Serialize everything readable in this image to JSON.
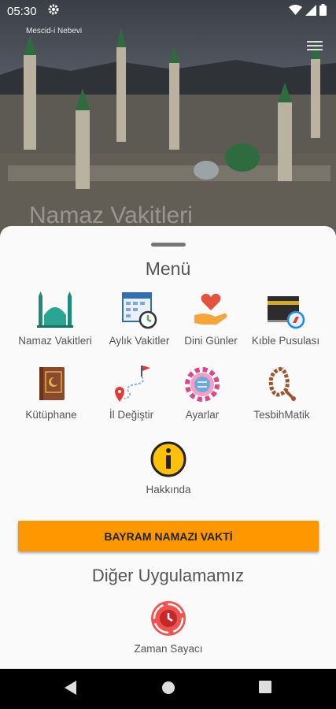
{
  "status": {
    "time": "05:30"
  },
  "header": {
    "place": "Mescid-i Nebevi",
    "bg_title": "Namaz Vakitleri"
  },
  "menu": {
    "title": "Menü",
    "items": [
      {
        "label": "Namaz Vakitleri",
        "icon": "mosque-icon"
      },
      {
        "label": "Aylık Vakitler",
        "icon": "monthly-calendar-icon"
      },
      {
        "label": "Dini Günler",
        "icon": "heart-hand-icon"
      },
      {
        "label": "Kıble Pusulası",
        "icon": "kaaba-compass-icon"
      },
      {
        "label": "Kütüphane",
        "icon": "book-icon"
      },
      {
        "label": "İl Değiştir",
        "icon": "route-pin-icon"
      },
      {
        "label": "Ayarlar",
        "icon": "gear-icon"
      },
      {
        "label": "TesbihMatik",
        "icon": "prayer-beads-icon"
      },
      {
        "label": "Hakkında",
        "icon": "info-icon"
      }
    ]
  },
  "bayram_button": {
    "label": "BAYRAM NAMAZI VAKTİ"
  },
  "other_apps": {
    "title": "Diğer Uygulamamız",
    "items": [
      {
        "label": "Zaman Sayacı",
        "icon": "timer-app-icon"
      }
    ]
  },
  "colors": {
    "accent": "#ff9800",
    "sheet": "#fafafa",
    "text": "#555555"
  }
}
